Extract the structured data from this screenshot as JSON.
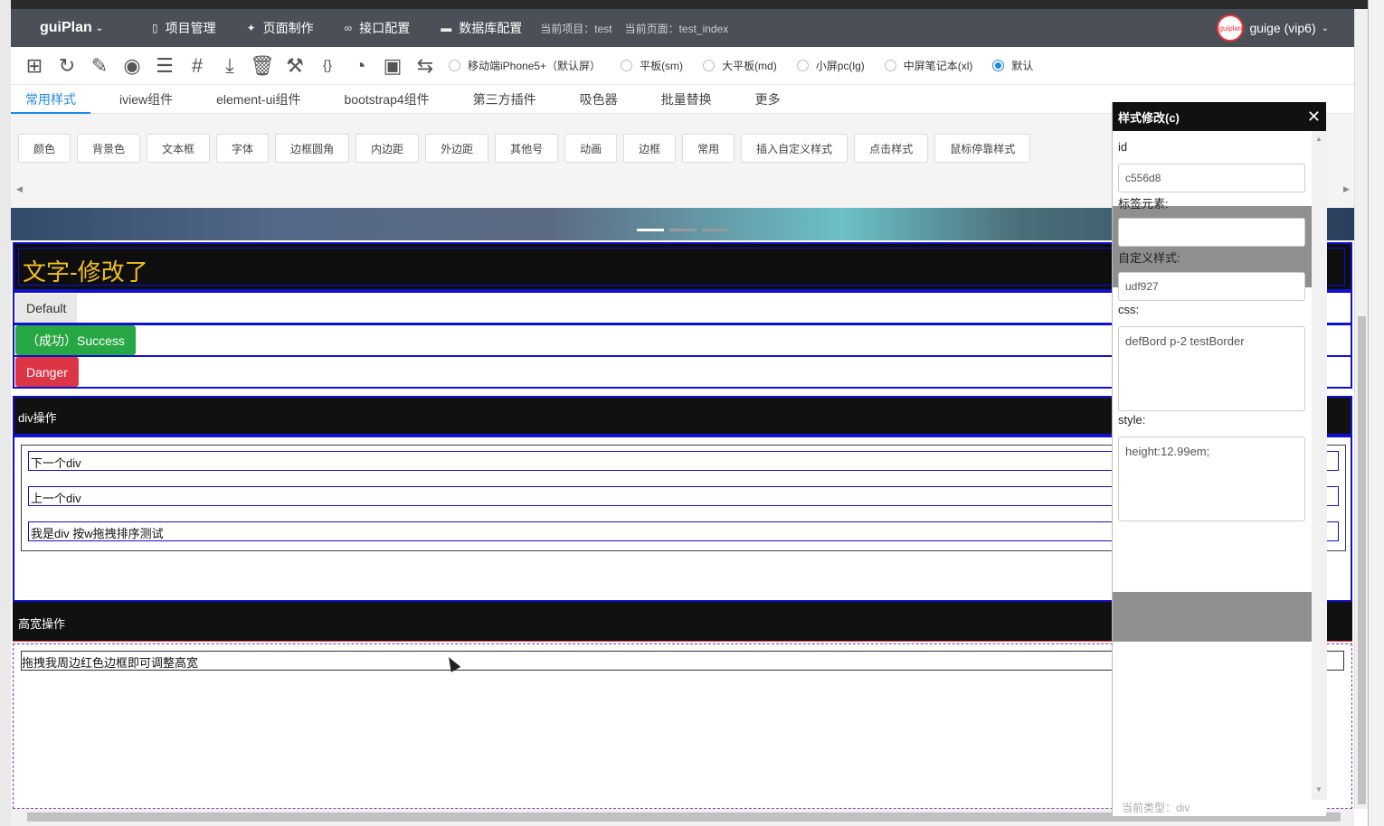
{
  "app": {
    "brand": "guiPlan",
    "nav": [
      {
        "icon": "document-icon",
        "glyph": "▯",
        "label": "项目管理"
      },
      {
        "icon": "tools-icon",
        "glyph": "✦",
        "label": "页面制作"
      },
      {
        "icon": "link-icon",
        "glyph": "∞",
        "label": "接口配置"
      },
      {
        "icon": "database-icon",
        "glyph": "▬",
        "label": "数据库配置"
      }
    ],
    "current_project": "当前项目：test",
    "current_page": "当前页面：test_index",
    "user": "guige (vip6)",
    "avatar_text": "guiplan"
  },
  "toolbar": {
    "tools": [
      {
        "name": "add-element-icon",
        "glyph": "⊞"
      },
      {
        "name": "refresh-icon",
        "glyph": "↻"
      },
      {
        "name": "eraser-icon",
        "glyph": "✎"
      },
      {
        "name": "eye-icon",
        "glyph": "◉"
      },
      {
        "name": "list-icon",
        "glyph": "☰"
      },
      {
        "name": "hash-icon",
        "glyph": "#"
      },
      {
        "name": "download-icon",
        "glyph": "⤓"
      },
      {
        "name": "trash-icon",
        "glyph": "🗑"
      },
      {
        "name": "broom-icon",
        "glyph": "⚒"
      },
      {
        "name": "code-icon",
        "glyph": "{}"
      },
      {
        "name": "palette-icon",
        "glyph": "◔"
      },
      {
        "name": "fullscreen-icon",
        "glyph": "▣"
      },
      {
        "name": "swap-icon",
        "glyph": "⇆"
      }
    ],
    "screens": [
      {
        "label": "移动端iPhone5+（默认屏）",
        "checked": false
      },
      {
        "label": "平板(sm)",
        "checked": false
      },
      {
        "label": "大平板(md)",
        "checked": false
      },
      {
        "label": "小屏pc(lg)",
        "checked": false
      },
      {
        "label": "中屏笔记本(xl)",
        "checked": false
      },
      {
        "label": "默认",
        "checked": true
      }
    ]
  },
  "tabs": [
    "常用样式",
    "iview组件",
    "element-ui组件",
    "bootstrap4组件",
    "第三方插件",
    "吸色器",
    "批量替换",
    "更多"
  ],
  "style_buttons": [
    "颜色",
    "背景色",
    "文本框",
    "字体",
    "边框圆角",
    "内边距",
    "外边距",
    "其他号",
    "动画",
    "边框",
    "常用",
    "插入自定义样式",
    "点击样式",
    "鼠标停靠样式"
  ],
  "canvas": {
    "title_text": "文字-修改了",
    "btn_default": "Default",
    "btn_success": "（成功）Success",
    "btn_danger": "Danger",
    "div_section": "div操作",
    "div_items": [
      "下一个div",
      "上一个div",
      "我是div 按w拖拽排序测试"
    ],
    "hw_section": "高宽操作",
    "hw_item": "拖拽我周边红色边框即可调整高宽"
  },
  "panel": {
    "title": "样式修改(c)",
    "close": "✕",
    "id_label": "id",
    "id_value": "c556d8",
    "tag_label": "标签元素:",
    "tag_value": "",
    "custom_label": "自定义样式:",
    "custom_value": "udf927",
    "css_label": "css:",
    "css_value": "defBord p-2 testBorder",
    "style_label": "style:",
    "style_value": "height:12.99em;",
    "footer": "当前类型：div"
  },
  "colors": {
    "topbar": "#4b4f57",
    "accent": "#1e88e5",
    "success": "#28a745",
    "danger": "#dc3545",
    "outline_blue": "#1010d0",
    "title_yellow": "#f0c020"
  }
}
